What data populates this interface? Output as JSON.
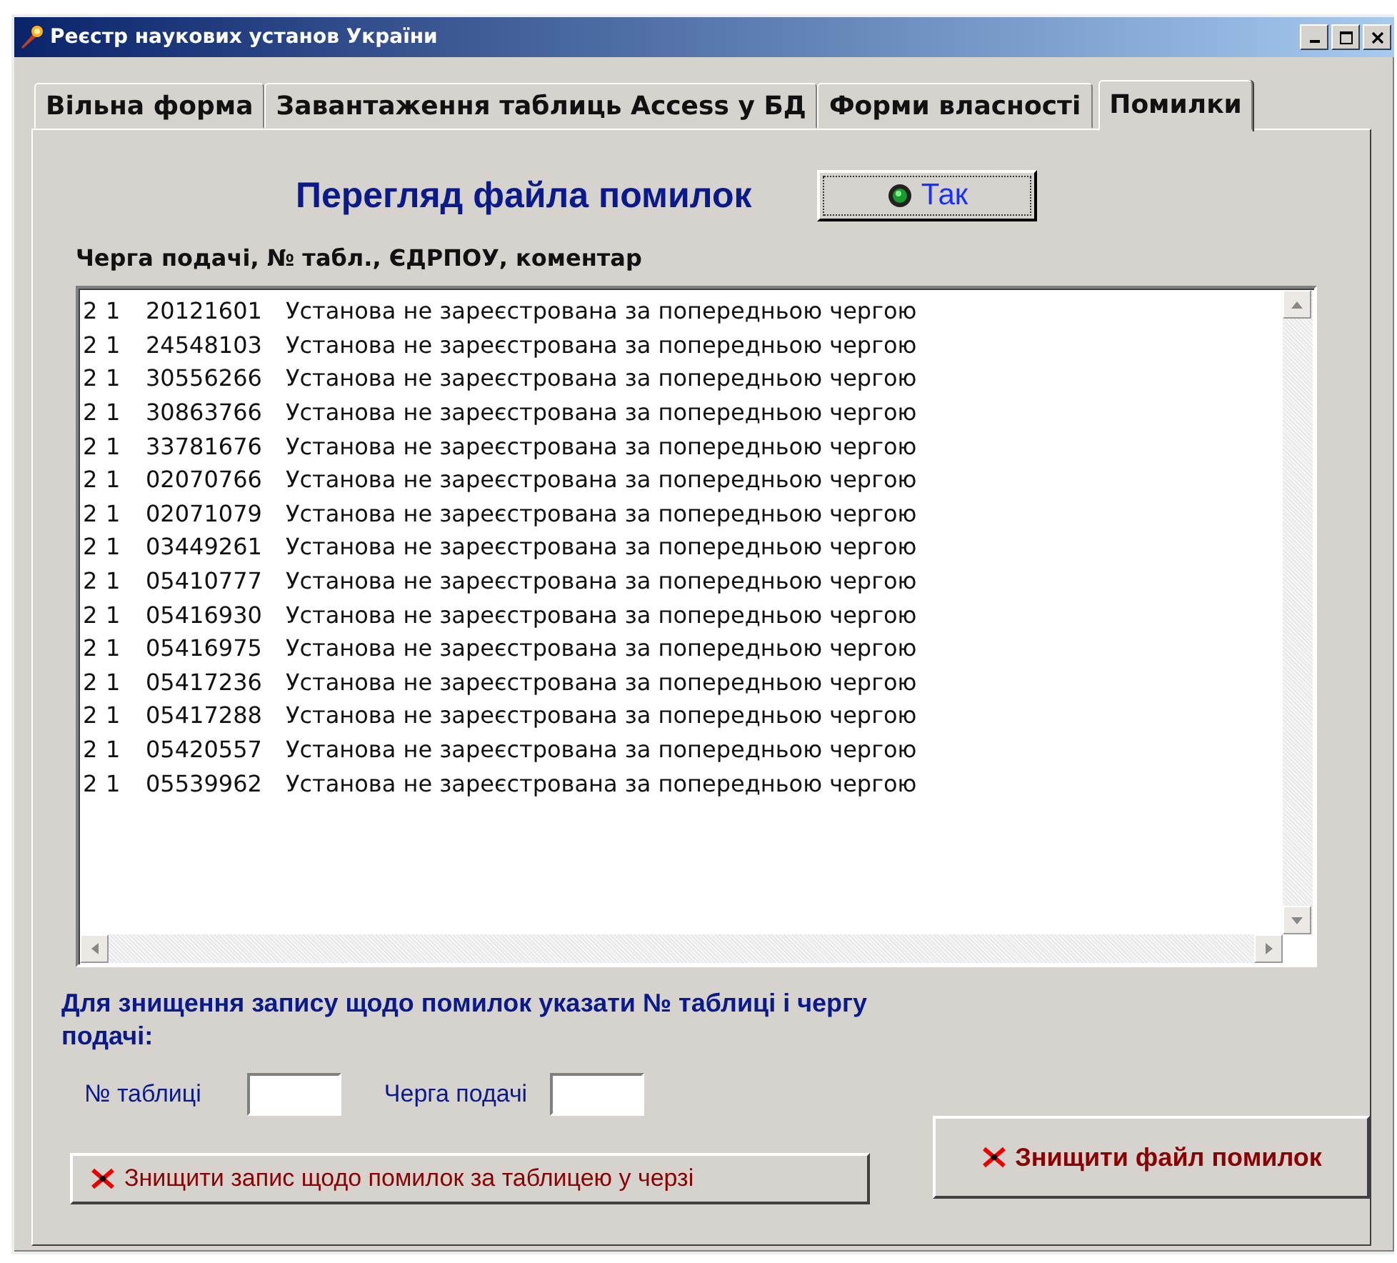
{
  "window": {
    "title": "Реєстр наукових установ України"
  },
  "tabs": [
    {
      "label": "Вільна форма",
      "selected": false
    },
    {
      "label": "Завантаження таблиць Access у БД",
      "selected": false
    },
    {
      "label": "Форми власності",
      "selected": false
    },
    {
      "label": "Помилки",
      "selected": true
    }
  ],
  "heading": "Перегляд файла помилок",
  "ok_button": {
    "label": "Так"
  },
  "list_label": "Черга подачі, № табл., ЄДРПОУ, коментар",
  "rows": [
    {
      "queue": "2",
      "table": "1",
      "code": "20121601",
      "comment": "Установа не зареєстрована за попередньою чергою"
    },
    {
      "queue": "2",
      "table": "1",
      "code": "24548103",
      "comment": "Установа не зареєстрована за попередньою чергою"
    },
    {
      "queue": "2",
      "table": "1",
      "code": "30556266",
      "comment": "Установа не зареєстрована за попередньою чергою"
    },
    {
      "queue": "2",
      "table": "1",
      "code": "30863766",
      "comment": "Установа не зареєстрована за попередньою чергою"
    },
    {
      "queue": "2",
      "table": "1",
      "code": "33781676",
      "comment": "Установа не зареєстрована за попередньою чергою"
    },
    {
      "queue": "2",
      "table": "1",
      "code": "02070766",
      "comment": "Установа не зареєстрована за попередньою чергою"
    },
    {
      "queue": "2",
      "table": "1",
      "code": "02071079",
      "comment": "Установа не зареєстрована за попередньою чергою"
    },
    {
      "queue": "2",
      "table": "1",
      "code": "03449261",
      "comment": "Установа не зареєстрована за попередньою чергою"
    },
    {
      "queue": "2",
      "table": "1",
      "code": "05410777",
      "comment": "Установа не зареєстрована за попередньою чергою"
    },
    {
      "queue": "2",
      "table": "1",
      "code": "05416930",
      "comment": "Установа не зареєстрована за попередньою чергою"
    },
    {
      "queue": "2",
      "table": "1",
      "code": "05416975",
      "comment": "Установа не зареєстрована за попередньою чергою"
    },
    {
      "queue": "2",
      "table": "1",
      "code": "05417236",
      "comment": "Установа не зареєстрована за попередньою чергою"
    },
    {
      "queue": "2",
      "table": "1",
      "code": "05417288",
      "comment": "Установа не зареєстрована за попередньою чергою"
    },
    {
      "queue": "2",
      "table": "1",
      "code": "05420557",
      "comment": "Установа не зареєстрована за попередньою чергою"
    },
    {
      "queue": "2",
      "table": "1",
      "code": "05539962",
      "comment": "Установа не зареєстрована за попередньою чергою"
    }
  ],
  "delete_hint": "Для знищення запису щодо помилок указати № таблиці і чергу подачі:",
  "fields": [
    {
      "label": "№ таблиці"
    },
    {
      "label": "Черга подачі"
    }
  ],
  "delete_record_button": {
    "label": "Знищити  запис щодо помилок за таблицею  у черзі"
  },
  "delete_file_button": {
    "label": "Знищити  файл помилок"
  }
}
